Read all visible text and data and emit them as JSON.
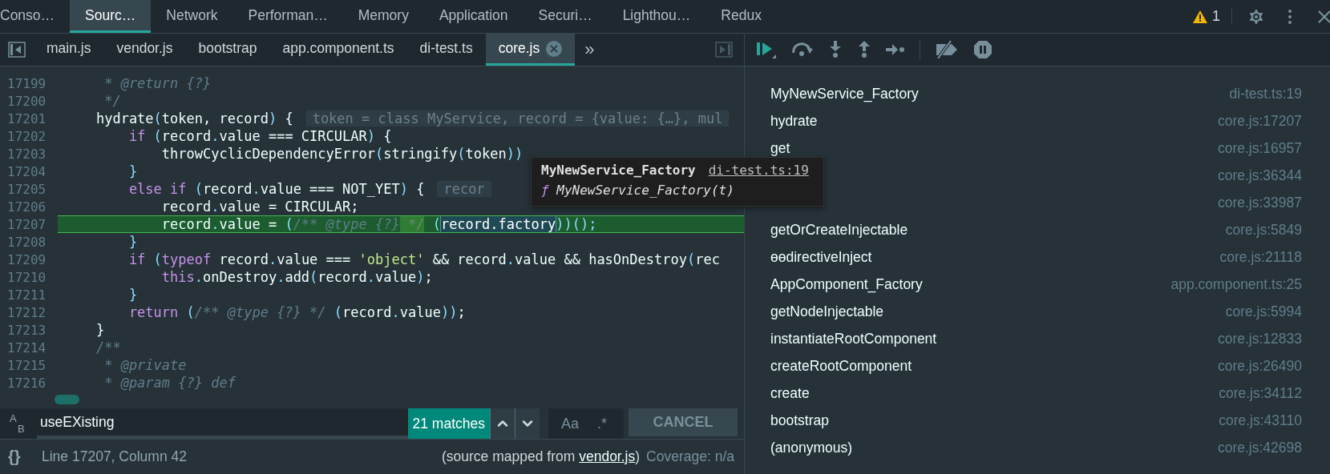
{
  "top_tabs": [
    {
      "label": "Conso…",
      "selected": false
    },
    {
      "label": "Sourc…",
      "selected": true
    },
    {
      "label": "Network",
      "selected": false
    },
    {
      "label": "Performan…",
      "selected": false
    },
    {
      "label": "Memory",
      "selected": false
    },
    {
      "label": "Application",
      "selected": false
    },
    {
      "label": "Securi…",
      "selected": false
    },
    {
      "label": "Lighthou…",
      "selected": false
    },
    {
      "label": "Redux",
      "selected": false
    }
  ],
  "warning_count": "1",
  "file_tabs": [
    {
      "label": "main.js",
      "selected": false,
      "closable": false
    },
    {
      "label": "vendor.js",
      "selected": false,
      "closable": false
    },
    {
      "label": "bootstrap",
      "selected": false,
      "closable": false
    },
    {
      "label": "app.component.ts",
      "selected": false,
      "closable": false
    },
    {
      "label": "di-test.ts",
      "selected": false,
      "closable": false
    },
    {
      "label": "core.js",
      "selected": true,
      "closable": true
    }
  ],
  "more_tabs": "»",
  "code_lines": [
    {
      "number": "17199",
      "current": false,
      "segments": [
        {
          "kind": "com",
          "text": "     * @return {?}"
        }
      ]
    },
    {
      "number": "17200",
      "current": false,
      "segments": [
        {
          "kind": "com",
          "text": "     */"
        }
      ]
    },
    {
      "number": "17201",
      "current": false,
      "segments": [
        {
          "kind": "txt",
          "text": "    hydrate"
        },
        {
          "kind": "pun",
          "text": "("
        },
        {
          "kind": "txt",
          "text": "token, record"
        },
        {
          "kind": "pun",
          "text": ")"
        },
        {
          "kind": "txt",
          "text": " {"
        },
        {
          "kind": "hint",
          "text": "token = class MyService, record = {value: {…}, mul"
        }
      ]
    },
    {
      "number": "17202",
      "current": false,
      "segments": [
        {
          "kind": "kw",
          "text": "        if"
        },
        {
          "kind": "pun",
          "text": " ("
        },
        {
          "kind": "txt",
          "text": "record"
        },
        {
          "kind": "pun",
          "text": "."
        },
        {
          "kind": "txt",
          "text": "value === CIRCULAR"
        },
        {
          "kind": "pun",
          "text": ")"
        },
        {
          "kind": "txt",
          "text": " {"
        }
      ]
    },
    {
      "number": "17203",
      "current": false,
      "segments": [
        {
          "kind": "txt",
          "text": "            throwCyclicDependencyError"
        },
        {
          "kind": "pun",
          "text": "("
        },
        {
          "kind": "txt",
          "text": "stringify"
        },
        {
          "kind": "pun",
          "text": "("
        },
        {
          "kind": "txt",
          "text": "token"
        },
        {
          "kind": "pun",
          "text": "))"
        }
      ]
    },
    {
      "number": "17204",
      "current": false,
      "segments": [
        {
          "kind": "pun",
          "text": "        }"
        }
      ]
    },
    {
      "number": "17205",
      "current": false,
      "segments": [
        {
          "kind": "kw",
          "text": "        else if"
        },
        {
          "kind": "pun",
          "text": " ("
        },
        {
          "kind": "txt",
          "text": "record"
        },
        {
          "kind": "pun",
          "text": "."
        },
        {
          "kind": "txt",
          "text": "value === NOT_YET"
        },
        {
          "kind": "pun",
          "text": ")"
        },
        {
          "kind": "txt",
          "text": " {"
        },
        {
          "kind": "hint",
          "text": "recor"
        }
      ]
    },
    {
      "number": "17206",
      "current": false,
      "segments": [
        {
          "kind": "txt",
          "text": "            record"
        },
        {
          "kind": "pun",
          "text": "."
        },
        {
          "kind": "txt",
          "text": "value = CIRCULAR;"
        }
      ]
    },
    {
      "number": "17207",
      "current": true,
      "segments": [
        {
          "kind": "txt",
          "text": "            record"
        },
        {
          "kind": "pun",
          "text": "."
        },
        {
          "kind": "txt",
          "text": "value = "
        },
        {
          "kind": "pun",
          "text": "("
        },
        {
          "kind": "com",
          "text": "/** @type {?}"
        },
        {
          "kind": "mark",
          "text": " */"
        },
        {
          "kind": "pun",
          "text": " ("
        },
        {
          "kind": "match",
          "text": "record.factory"
        },
        {
          "kind": "pun",
          "text": "))();"
        }
      ]
    },
    {
      "number": "17208",
      "current": false,
      "segments": [
        {
          "kind": "pun",
          "text": "        }"
        }
      ]
    },
    {
      "number": "17209",
      "current": false,
      "segments": [
        {
          "kind": "kw",
          "text": "        if"
        },
        {
          "kind": "pun",
          "text": " ("
        },
        {
          "kind": "kw",
          "text": "typeof"
        },
        {
          "kind": "txt",
          "text": " record"
        },
        {
          "kind": "pun",
          "text": "."
        },
        {
          "kind": "txt",
          "text": "value === "
        },
        {
          "kind": "str",
          "text": "'object'"
        },
        {
          "kind": "txt",
          "text": " && record"
        },
        {
          "kind": "pun",
          "text": "."
        },
        {
          "kind": "txt",
          "text": "value && hasOnDestroy"
        },
        {
          "kind": "pun",
          "text": "("
        },
        {
          "kind": "txt",
          "text": "rec"
        }
      ]
    },
    {
      "number": "17210",
      "current": false,
      "segments": [
        {
          "kind": "kw",
          "text": "            this"
        },
        {
          "kind": "pun",
          "text": "."
        },
        {
          "kind": "txt",
          "text": "onDestroy"
        },
        {
          "kind": "pun",
          "text": "."
        },
        {
          "kind": "txt",
          "text": "add"
        },
        {
          "kind": "pun",
          "text": "("
        },
        {
          "kind": "txt",
          "text": "record"
        },
        {
          "kind": "pun",
          "text": "."
        },
        {
          "kind": "txt",
          "text": "value"
        },
        {
          "kind": "pun",
          "text": ")"
        },
        {
          "kind": "txt",
          "text": ";"
        }
      ]
    },
    {
      "number": "17211",
      "current": false,
      "segments": [
        {
          "kind": "pun",
          "text": "        }"
        }
      ]
    },
    {
      "number": "17212",
      "current": false,
      "segments": [
        {
          "kind": "kw",
          "text": "        return"
        },
        {
          "kind": "pun",
          "text": " ("
        },
        {
          "kind": "com",
          "text": "/** @type {?} */"
        },
        {
          "kind": "pun",
          "text": " ("
        },
        {
          "kind": "txt",
          "text": "record"
        },
        {
          "kind": "pun",
          "text": "."
        },
        {
          "kind": "txt",
          "text": "value"
        },
        {
          "kind": "pun",
          "text": "))"
        },
        {
          "kind": "txt",
          "text": ";"
        }
      ]
    },
    {
      "number": "17213",
      "current": false,
      "segments": [
        {
          "kind": "txt",
          "text": "    }"
        }
      ]
    },
    {
      "number": "17214",
      "current": false,
      "segments": [
        {
          "kind": "com",
          "text": "    /**"
        }
      ]
    },
    {
      "number": "17215",
      "current": false,
      "segments": [
        {
          "kind": "com",
          "text": "     * @private"
        }
      ]
    },
    {
      "number": "17216",
      "current": false,
      "segments": [
        {
          "kind": "com",
          "text": "     * @param {?} def"
        }
      ]
    }
  ],
  "tooltip": {
    "name": "MyNewService_Factory",
    "location": "di-test.ts:19",
    "glyph": "ƒ",
    "signature": "MyNewService_Factory(t)"
  },
  "search": {
    "toggle_top": "A",
    "toggle_bottom": "B",
    "value": "useEXisting",
    "matches": "21 matches",
    "case_label": "Aa",
    "regex_label": ".*",
    "cancel": "CANCEL"
  },
  "status": {
    "brace": "{}",
    "position": "Line 17207, Column 42",
    "mapped_prefix": "(source mapped from ",
    "mapped_link": "vendor.js",
    "mapped_suffix": ")",
    "coverage": "Coverage: n/a"
  },
  "call_stack": [
    {
      "name": "MyNewService_Factory",
      "location": "di-test.ts:19"
    },
    {
      "name": "hydrate",
      "location": "core.js:17207"
    },
    {
      "name": "get",
      "location": "core.js:16957"
    },
    {
      "location": "core.js:36344"
    },
    {
      "location": "core.js:33987"
    },
    {
      "name": "getOrCreateInjectable",
      "location": "core.js:5849"
    },
    {
      "name": "ɵɵdirectiveInject",
      "location": "core.js:21118"
    },
    {
      "name": "AppComponent_Factory",
      "location": "app.component.ts:25"
    },
    {
      "name": "getNodeInjectable",
      "location": "core.js:5994"
    },
    {
      "name": "instantiateRootComponent",
      "location": "core.js:12833"
    },
    {
      "name": "createRootComponent",
      "location": "core.js:26490"
    },
    {
      "name": "create",
      "location": "core.js:34112"
    },
    {
      "name": "bootstrap",
      "location": "core.js:43110"
    },
    {
      "name": "(anonymous)",
      "location": "core.js:42698"
    }
  ]
}
